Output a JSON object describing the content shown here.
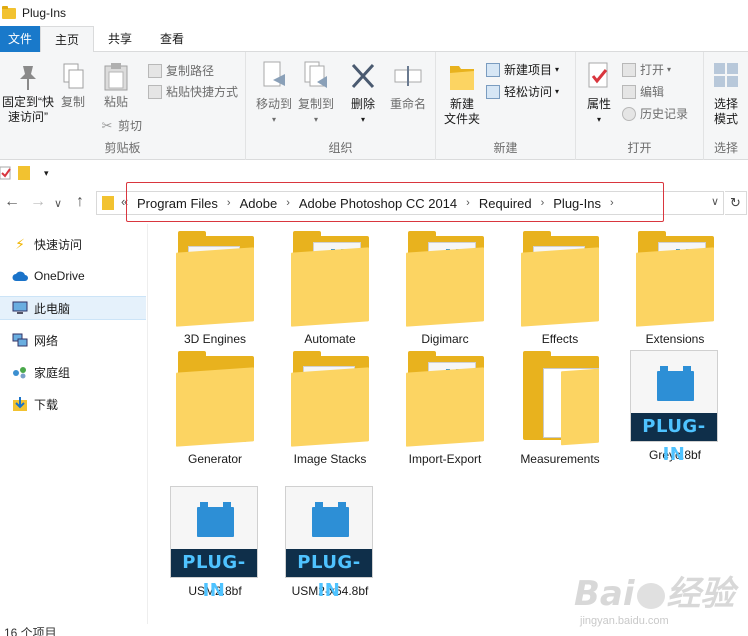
{
  "window": {
    "title": "Plug-Ins"
  },
  "tabs": [
    {
      "label": "文件",
      "kind": "file"
    },
    {
      "label": "主页",
      "kind": "active"
    },
    {
      "label": "共享",
      "kind": "normal"
    },
    {
      "label": "查看",
      "kind": "normal"
    }
  ],
  "ribbon": {
    "clipboard": {
      "label": "剪贴板",
      "pin": "固定到“快速访问”",
      "copy": "复制",
      "paste": "粘贴",
      "copy_path": "复制路径",
      "paste_shortcut": "粘贴快捷方式",
      "cut": "剪切"
    },
    "organize": {
      "label": "组织",
      "move_to": "移动到",
      "copy_to": "复制到",
      "delete": "删除",
      "rename": "重命名"
    },
    "new": {
      "label": "新建",
      "new_folder": "新建\n文件夹",
      "new_item": "新建项目",
      "easy_access": "轻松访问"
    },
    "open": {
      "label": "打开",
      "properties": "属性",
      "open": "打开",
      "edit": "编辑",
      "history": "历史记录"
    },
    "select": {
      "label": "选择",
      "select_mode": "选择\n模式"
    }
  },
  "address": {
    "overflow": "«",
    "crumbs": [
      "Program Files",
      "Adobe",
      "Adobe Photoshop CC 2014",
      "Required",
      "Plug-Ins"
    ]
  },
  "sidebar": {
    "items": [
      {
        "label": "快速访问",
        "icon": "lightning-icon",
        "selected": false
      },
      {
        "label": "OneDrive",
        "icon": "cloud-icon",
        "selected": false
      },
      {
        "label": "此电脑",
        "icon": "computer-icon",
        "selected": true
      },
      {
        "label": "网络",
        "icon": "network-icon",
        "selected": false
      },
      {
        "label": "家庭组",
        "icon": "homegroup-icon",
        "selected": false
      },
      {
        "label": "下载",
        "icon": "download-icon",
        "selected": false
      }
    ]
  },
  "files": [
    {
      "name": "3D Engines",
      "type": "folder-plugin"
    },
    {
      "name": "Automate",
      "type": "folder-plugin-stack"
    },
    {
      "name": "Digimarc",
      "type": "folder-plugin-stack"
    },
    {
      "name": "Effects",
      "type": "folder-plugin"
    },
    {
      "name": "Extensions",
      "type": "folder-plugin-stack"
    },
    {
      "name": "Generator",
      "type": "folder-doc"
    },
    {
      "name": "Image Stacks",
      "type": "folder-plugin"
    },
    {
      "name": "Import-Export",
      "type": "folder-plugin-stack"
    },
    {
      "name": "Measurements",
      "type": "folder-blank"
    },
    {
      "name": "Greyc.8bf",
      "type": "plugin"
    },
    {
      "name": "USM2.8bf",
      "type": "plugin"
    },
    {
      "name": "USM2-x64.8bf",
      "type": "plugin"
    }
  ],
  "plugin_text": "PLUG-IN",
  "status": {
    "count": "16 个项目"
  },
  "watermark": {
    "brand": "Bai du 经验",
    "url": "jingyan.baidu.com"
  }
}
